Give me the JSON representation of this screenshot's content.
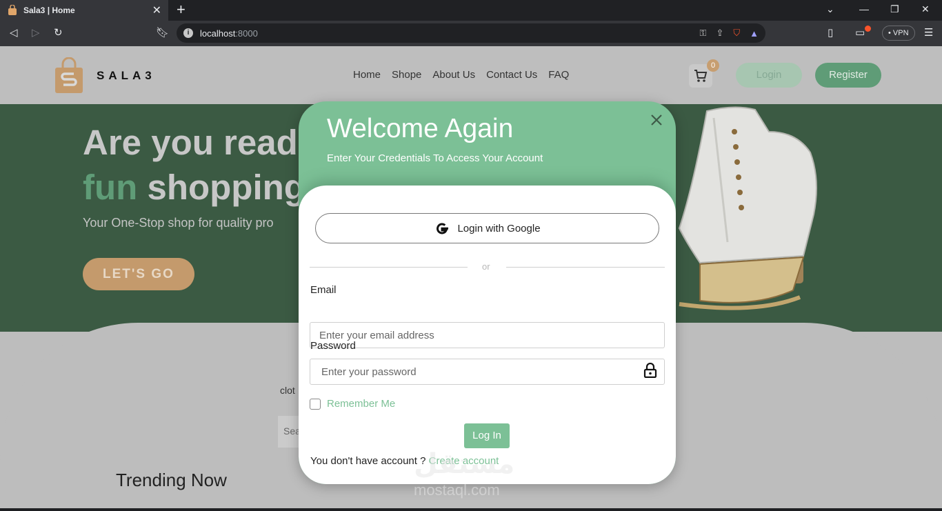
{
  "browser": {
    "tab_title": "Sala3 | Home",
    "tab_close": "✕",
    "new_tab": "+",
    "url_host": "localhost",
    "url_port": ":8000",
    "vpn_label": "• VPN",
    "icons": [
      "back-icon",
      "forward-icon",
      "reload-icon",
      "bookmark-icon",
      "key-icon",
      "share-icon",
      "brave-shield-icon",
      "brave-rewards-icon",
      "sidebar-icon",
      "wallet-icon",
      "menu-icon"
    ]
  },
  "header": {
    "logo_text": "SALA3",
    "nav": [
      "Home",
      "Shope",
      "About Us",
      "Contact Us",
      "FAQ"
    ],
    "cart_count": "0",
    "login_label": "Login",
    "register_label": "Register"
  },
  "hero": {
    "line1": "Are you read",
    "line2_accent": "fun",
    "line2_rest": " shopping",
    "subtitle": "Your One-Stop shop for quality pro",
    "cta_label": "LET'S GO"
  },
  "lower": {
    "clot_text": "clot",
    "search_stub": "Sea",
    "trending_title": "Trending Now"
  },
  "modal": {
    "title": "Welcome Again",
    "subtitle": "Enter Your Credentials To Access Your Account",
    "google_label": "Login with Google",
    "divider_text": "or",
    "email_label": "Email",
    "email_placeholder": "Enter your email address",
    "password_label": "Password",
    "password_placeholder": "Enter your password",
    "remember_label": "Remember Me",
    "submit_label": "Log In",
    "signup_prompt": "You don't have account ? ",
    "signup_link": "Create account"
  },
  "watermark": {
    "arabic": "مستقل",
    "latin": "mostaql.com"
  },
  "colors": {
    "brand_green": "#7cc096",
    "brand_dark_green": "#5f9c77",
    "brand_tan": "#c49a6c"
  }
}
